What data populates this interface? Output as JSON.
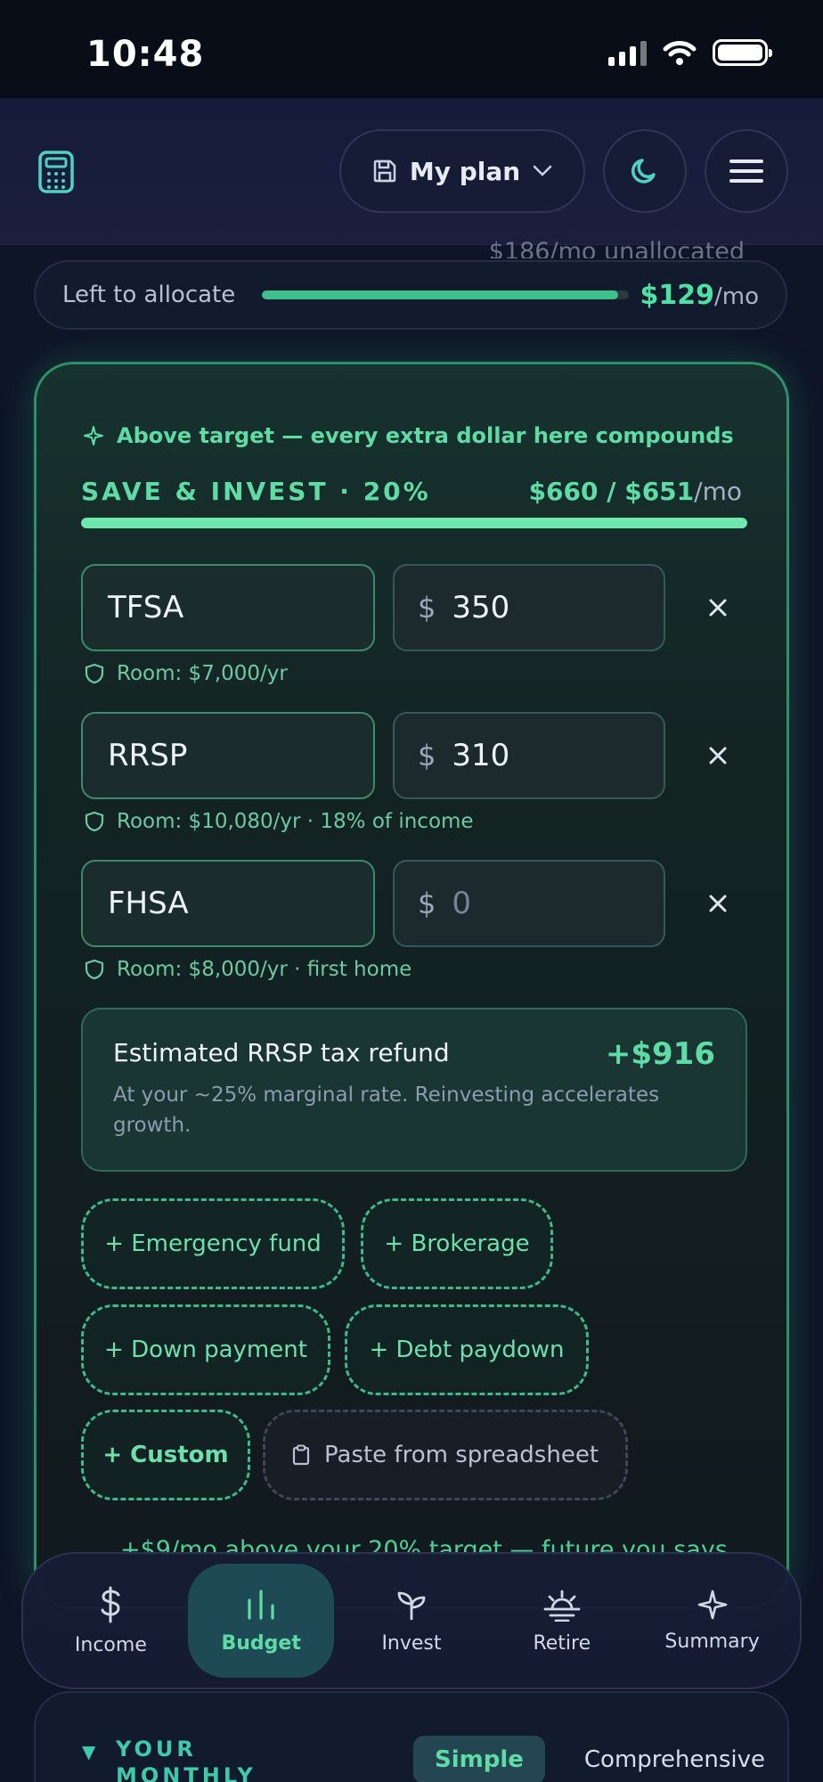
{
  "status": {
    "time": "10:48"
  },
  "header": {
    "plan_label": "My plan"
  },
  "allocation": {
    "ghost_text": "$186/mo unallocated",
    "left_label": "Left to allocate",
    "left_amount": "$129",
    "left_unit": "/mo",
    "left_fraction": 0.97
  },
  "save_invest": {
    "hint": "Above target — every extra dollar here compounds",
    "title": "SAVE & INVEST · 20%",
    "amount": "$660 / $651",
    "unit": "/mo",
    "progress": 1.0,
    "accounts": [
      {
        "name": "TFSA",
        "currency": "$",
        "value": "350",
        "room": "Room: $7,000/yr"
      },
      {
        "name": "RRSP",
        "currency": "$",
        "value": "310",
        "room": "Room: $10,080/yr · 18% of income"
      },
      {
        "name": "FHSA",
        "currency": "$",
        "value": "0",
        "room": "Room: $8,000/yr · first home"
      }
    ],
    "refund": {
      "title": "Estimated RRSP tax refund",
      "value": "+$916",
      "desc": "At your ~25% marginal rate. Reinvesting accelerates growth."
    },
    "chips": {
      "emergency": "+ Emergency fund",
      "brokerage": "+ Brokerage",
      "down_payment": "+ Down payment",
      "debt": "+ Debt paydown",
      "custom": "+ Custom",
      "paste": "Paste from spreadsheet"
    },
    "footer_ghost": "+$9/mo above your 20% target — future you says"
  },
  "tabs": [
    {
      "label": "Income",
      "icon": "dollar-icon"
    },
    {
      "label": "Budget",
      "icon": "bar-chart-icon"
    },
    {
      "label": "Invest",
      "icon": "sprout-icon"
    },
    {
      "label": "Retire",
      "icon": "sunset-icon"
    },
    {
      "label": "Summary",
      "icon": "sparkle-icon"
    }
  ],
  "split": {
    "title": "YOUR MONTHLY SPLIT",
    "mode_simple": "Simple",
    "mode_comprehensive": "Comprehensive"
  },
  "colors": {
    "accent": "#5fdca6",
    "background": "#0e1526",
    "card_border": "#2f8f68"
  }
}
